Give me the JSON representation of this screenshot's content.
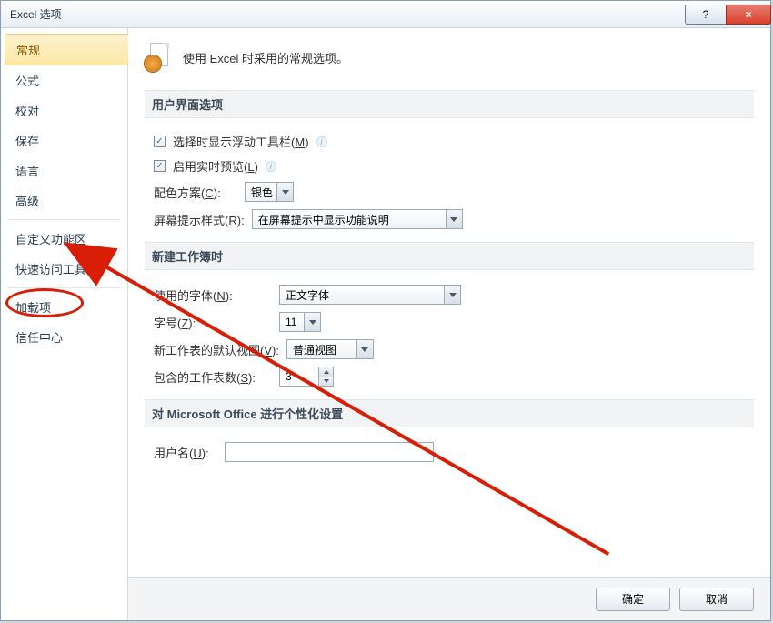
{
  "window": {
    "title": "Excel 选项"
  },
  "titlebar_buttons": {
    "help": "?",
    "close": "×"
  },
  "nav": {
    "items": [
      "常规",
      "公式",
      "校对",
      "保存",
      "语言",
      "高级",
      "自定义功能区",
      "快速访问工具栏",
      "加载项",
      "信任中心"
    ],
    "selected_index": 0,
    "highlight_index": 8
  },
  "intro": {
    "text": "使用 Excel 时采用的常规选项。"
  },
  "sections": {
    "ui": {
      "head": "用户界面选项",
      "mini_toolbar": {
        "label_pre": "选择时显示浮动工具栏(",
        "key": "M",
        "label_post": ")",
        "checked": true
      },
      "live_preview": {
        "label_pre": "启用实时预览(",
        "key": "L",
        "label_post": ")",
        "checked": true
      },
      "color_scheme": {
        "label_pre": "配色方案(",
        "key": "C",
        "label_post": "):",
        "value": "银色"
      },
      "screentip": {
        "label_pre": "屏幕提示样式(",
        "key": "R",
        "label_post": "):",
        "value": "在屏幕提示中显示功能说明"
      }
    },
    "new_wb": {
      "head": "新建工作簿时",
      "font": {
        "label_pre": "使用的字体(",
        "key": "N",
        "label_post": "):",
        "value": "正文字体"
      },
      "size": {
        "label_pre": "字号(",
        "key": "Z",
        "label_post": "):",
        "value": "11"
      },
      "view": {
        "label_pre": "新工作表的默认视图(",
        "key": "V",
        "label_post": "):",
        "value": "普通视图"
      },
      "sheets": {
        "label_pre": "包含的工作表数(",
        "key": "S",
        "label_post": "):",
        "value": "3"
      }
    },
    "personal": {
      "head": "对 Microsoft Office 进行个性化设置",
      "username": {
        "label_pre": "用户名(",
        "key": "U",
        "label_post": "):",
        "value": ""
      }
    }
  },
  "footer": {
    "ok": "确定",
    "cancel": "取消"
  }
}
